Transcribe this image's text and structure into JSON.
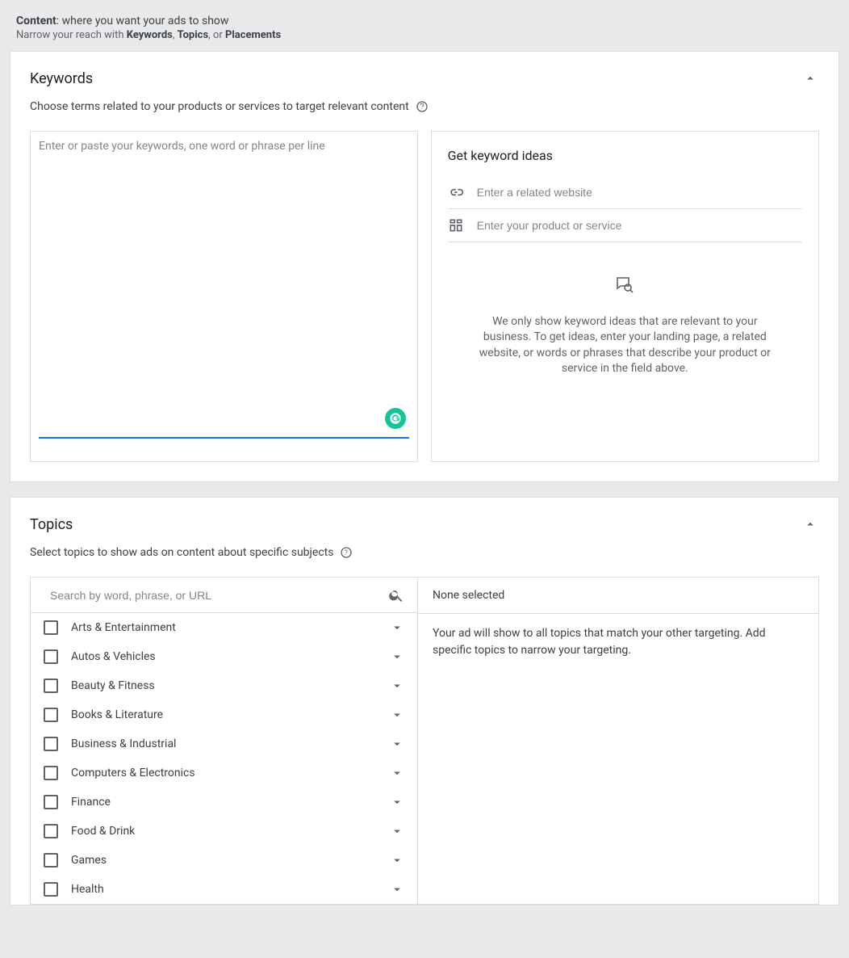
{
  "header": {
    "title_bold": "Content",
    "title_rest": ": where you want your ads to show",
    "subline_prefix": "Narrow your reach with ",
    "kw": "Keywords",
    "sep1": ", ",
    "tp": "Topics",
    "sep2": ", or ",
    "pl": "Placements"
  },
  "keywords": {
    "heading": "Keywords",
    "subtitle": "Choose terms related to your products or services to target relevant content",
    "textarea_placeholder": "Enter or paste your keywords, one word or phrase per line",
    "ideas_heading": "Get keyword ideas",
    "website_placeholder": "Enter a related website",
    "product_placeholder": "Enter your product or service",
    "empty_msg": "We only show keyword ideas that are relevant to your business. To get ideas, enter your landing page, a related website, or words or phrases that describe your product or service in the field above."
  },
  "topics": {
    "heading": "Topics",
    "subtitle": "Select topics to show ads on content about specific subjects",
    "search_placeholder": "Search by word, phrase, or URL",
    "none_selected": "None selected",
    "hint": "Your ad will show to all topics that match your other targeting. Add specific topics to narrow your targeting.",
    "items": [
      {
        "label": "Arts & Entertainment"
      },
      {
        "label": "Autos & Vehicles"
      },
      {
        "label": "Beauty & Fitness"
      },
      {
        "label": "Books & Literature"
      },
      {
        "label": "Business & Industrial"
      },
      {
        "label": "Computers & Electronics"
      },
      {
        "label": "Finance"
      },
      {
        "label": "Food & Drink"
      },
      {
        "label": "Games"
      },
      {
        "label": "Health"
      }
    ]
  }
}
